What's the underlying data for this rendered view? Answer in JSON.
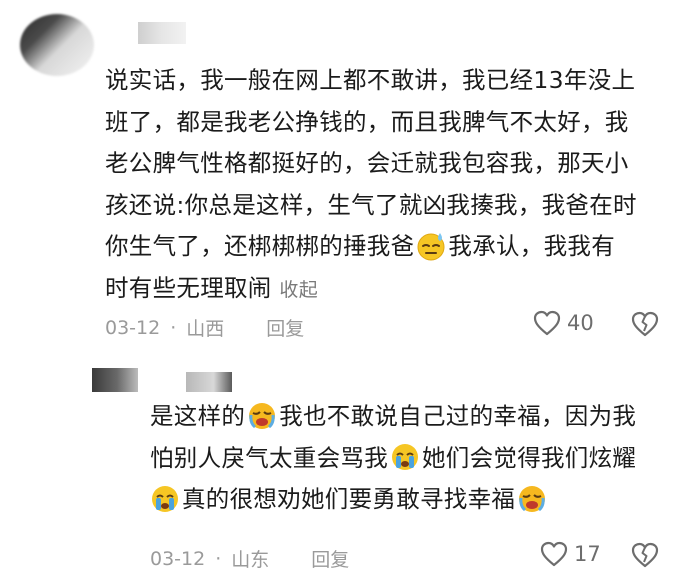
{
  "comment": {
    "lines": [
      "说实话，我一般在网上都不敢讲，我已经13年没上",
      "班了，都是我老公挣钱的，而且我脾气不太好，我",
      "老公脾气性格都挺好的，会迁就我包容我，那天小",
      "孩还说:你总是这样，生气了就凶我揍我，我爸在时",
      "你生气了，还梆梆梆的捶我爸",
      "我承认，我我有",
      "时有些无理取闹"
    ],
    "collapse_label": "收起",
    "date": "03-12",
    "location": "山西",
    "reply_label": "回复",
    "likes": "40",
    "emoji_icon": "sweat-face-icon"
  },
  "reply": {
    "lines": [
      "是这样的",
      "我也不敢说自己过的幸福，因为我",
      "怕别人戾气太重会骂我",
      "她们会觉得我们炫耀",
      "真的很想劝她们要勇敢寻找幸福"
    ],
    "date": "03-12",
    "location": "山东",
    "reply_label": "回复",
    "likes": "17",
    "emoji_icons": [
      "loudly-crying-face-icon",
      "crying-face-icon",
      "crying-face-icon",
      "loudly-crying-face-icon"
    ]
  },
  "separator": "·"
}
